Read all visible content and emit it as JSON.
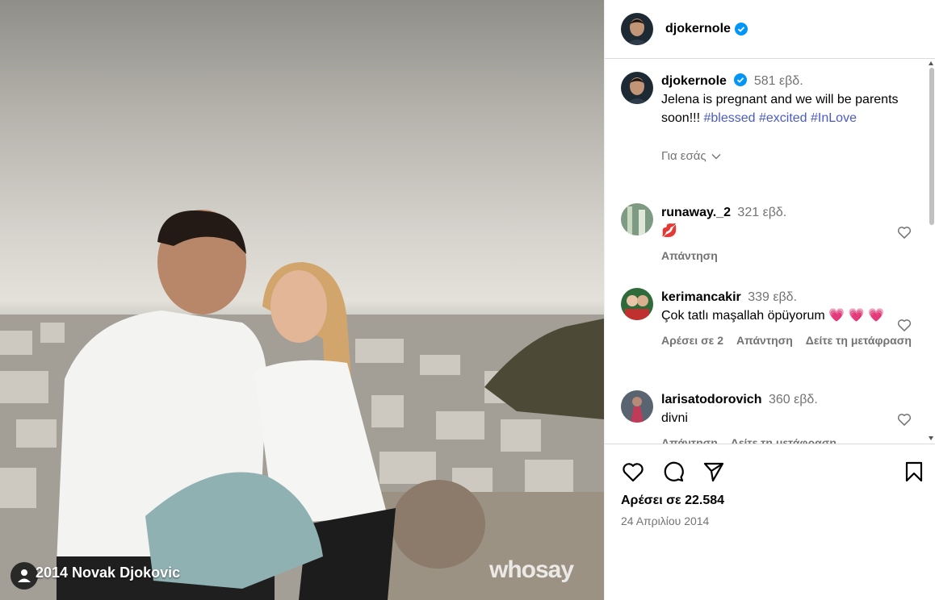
{
  "photo": {
    "credit": "2014 Novak Djokovic",
    "watermark": "whosay"
  },
  "header": {
    "username": "djokernole"
  },
  "caption": {
    "username": "djokernole",
    "time": "581 εβδ.",
    "text": "Jelena is pregnant and we will be parents soon!!!",
    "hashtags": [
      "#blessed",
      "#excited",
      "#InLove"
    ],
    "see_translation": "Για εσάς"
  },
  "comments": [
    {
      "username": "runaway._2",
      "time": "321 εβδ.",
      "text": "💋",
      "actions": [
        "Απάντηση"
      ]
    },
    {
      "username": "kerimancakir",
      "time": "339 εβδ.",
      "text": "Çok tatlı maşallah öpüyorum 💗 💗 💗",
      "actions": [
        "Αρέσει σε 2",
        "Απάντηση",
        "Δείτε τη μετάφραση"
      ]
    },
    {
      "username": "larisatodorovich",
      "time": "360 εβδ.",
      "text": "divni",
      "actions": [
        "Απάντηση",
        "Δείτε τη μετάφραση"
      ]
    }
  ],
  "footer": {
    "likes": "Αρέσει σε 22.584",
    "date": "24 Απριλίου 2014"
  },
  "icons": {
    "like": "heart-icon",
    "comment": "comment-icon",
    "share": "share-icon",
    "save": "bookmark-icon",
    "verified": "verified-badge-icon"
  },
  "colors": {
    "verified": "#0095f6",
    "hashtag": "#4a5bc9",
    "muted": "#737373"
  }
}
